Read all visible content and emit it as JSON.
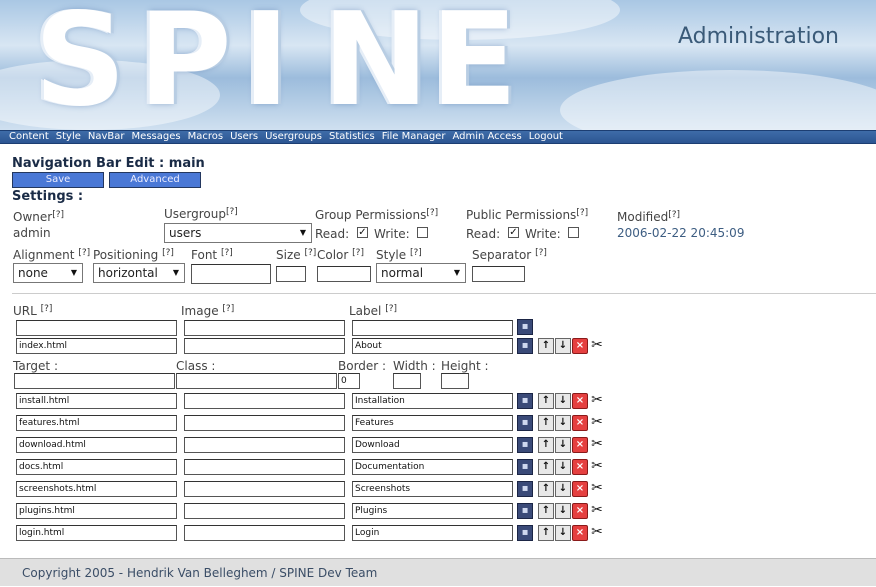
{
  "banner": {
    "logo_letters": [
      "S",
      "P",
      "I",
      "N",
      "E"
    ],
    "title": "Administration"
  },
  "menu": [
    "Content",
    "Style",
    "NavBar",
    "Messages",
    "Macros",
    "Users",
    "Usergroups",
    "Statistics",
    "File Manager",
    "Admin Access",
    "Logout"
  ],
  "page": {
    "heading": "Navigation Bar Edit : main",
    "save_label": "Save",
    "advanced_label": "Advanced",
    "settings_label": "Settings :"
  },
  "help_marker": "[?]",
  "settings": {
    "owner_label": "Owner",
    "owner_value": "admin",
    "usergroup_label": "Usergroup",
    "usergroup_value": "users",
    "group_perm_label": "Group Permissions",
    "public_perm_label": "Public Permissions",
    "read_label": "Read:",
    "write_label": "Write:",
    "modified_label": "Modified",
    "modified_value": "2006-02-22 20:45:09",
    "alignment_label": "Alignment",
    "alignment_value": "none",
    "positioning_label": "Positioning",
    "positioning_value": "horizontal",
    "font_label": "Font",
    "size_label": "Size",
    "color_label": "Color",
    "style_label": "Style",
    "style_value": "normal",
    "separator_label": "Separator"
  },
  "items_header": {
    "url": "URL",
    "image": "Image",
    "label": "Label"
  },
  "first_item": {
    "url": "index.html",
    "image": "",
    "label": "About"
  },
  "advanced_header": {
    "target": "Target :",
    "class": "Class :",
    "border": "Border :",
    "width": "Width :",
    "height": "Height :",
    "border_value": "0"
  },
  "items": [
    {
      "url": "install.html",
      "image": "",
      "label": "Installation"
    },
    {
      "url": "features.html",
      "image": "",
      "label": "Features"
    },
    {
      "url": "download.html",
      "image": "",
      "label": "Download"
    },
    {
      "url": "docs.html",
      "image": "",
      "label": "Documentation"
    },
    {
      "url": "screenshots.html",
      "image": "",
      "label": "Screenshots"
    },
    {
      "url": "plugins.html",
      "image": "",
      "label": "Plugins"
    },
    {
      "url": "login.html",
      "image": "",
      "label": "Login"
    }
  ],
  "icons": {
    "save": "floppy-save-icon",
    "up": "arrow-up-icon",
    "down": "arrow-down-icon",
    "delete": "delete-x-icon",
    "tool": "tools-icon"
  },
  "footer": "Copyright 2005 - Hendrik Van Belleghem / SPINE Dev Team"
}
